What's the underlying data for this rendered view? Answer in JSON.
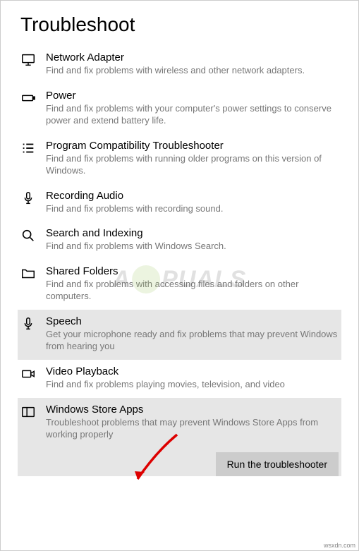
{
  "page": {
    "heading": "Troubleshoot"
  },
  "items": [
    {
      "title": "Network Adapter",
      "desc": "Find and fix problems with wireless and other network adapters."
    },
    {
      "title": "Power",
      "desc": "Find and fix problems with your computer's power settings to conserve power and extend battery life."
    },
    {
      "title": "Program Compatibility Troubleshooter",
      "desc": "Find and fix problems with running older programs on this version of Windows."
    },
    {
      "title": "Recording Audio",
      "desc": "Find and fix problems with recording sound."
    },
    {
      "title": "Search and Indexing",
      "desc": "Find and fix problems with Windows Search."
    },
    {
      "title": "Shared Folders",
      "desc": "Find and fix problems with accessing files and folders on other computers."
    },
    {
      "title": "Speech",
      "desc": "Get your microphone ready and fix problems that may prevent Windows from hearing you"
    },
    {
      "title": "Video Playback",
      "desc": "Find and fix problems playing movies, television, and video"
    },
    {
      "title": "Windows Store Apps",
      "desc": "Troubleshoot problems that may prevent Windows Store Apps from working properly"
    }
  ],
  "button": {
    "run": "Run the troubleshooter"
  },
  "watermark": {
    "left": "A",
    "right": "PUALS"
  },
  "footer": "wsxdn.com"
}
